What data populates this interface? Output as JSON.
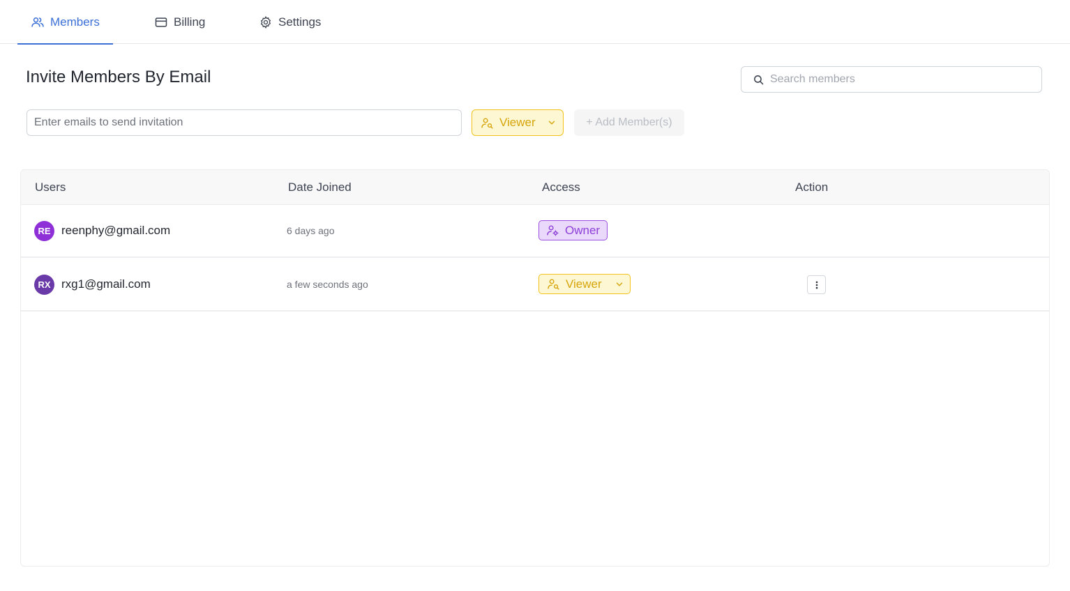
{
  "tabs": [
    {
      "label": "Members",
      "icon": "users-icon",
      "active": true
    },
    {
      "label": "Billing",
      "icon": "credit-card-icon",
      "active": false
    },
    {
      "label": "Settings",
      "icon": "gear-icon",
      "active": false
    }
  ],
  "invite": {
    "title": "Invite Members By Email",
    "email_placeholder": "Enter emails to send invitation",
    "email_value": "",
    "role": "Viewer",
    "add_label": "+ Add Member(s)"
  },
  "search": {
    "placeholder": "Search members",
    "value": ""
  },
  "table": {
    "headers": [
      "Users",
      "Date Joined",
      "Access",
      "Action"
    ],
    "rows": [
      {
        "initials": "RE",
        "avatar_color": "#8e2fd8",
        "email": "reenphy@gmail.com",
        "date_joined": "6 days ago",
        "access": "Owner",
        "has_action": false
      },
      {
        "initials": "RX",
        "avatar_color": "#6a3ba8",
        "email": "rxg1@gmail.com",
        "date_joined": "a few seconds ago",
        "access": "Viewer",
        "has_action": true
      }
    ]
  },
  "colors": {
    "accent": "#3b6fd6",
    "viewer_bg": "#fef7d3",
    "viewer_border": "#f2c21b",
    "owner_bg": "#ead9fb",
    "owner_border": "#9b4fe0"
  }
}
